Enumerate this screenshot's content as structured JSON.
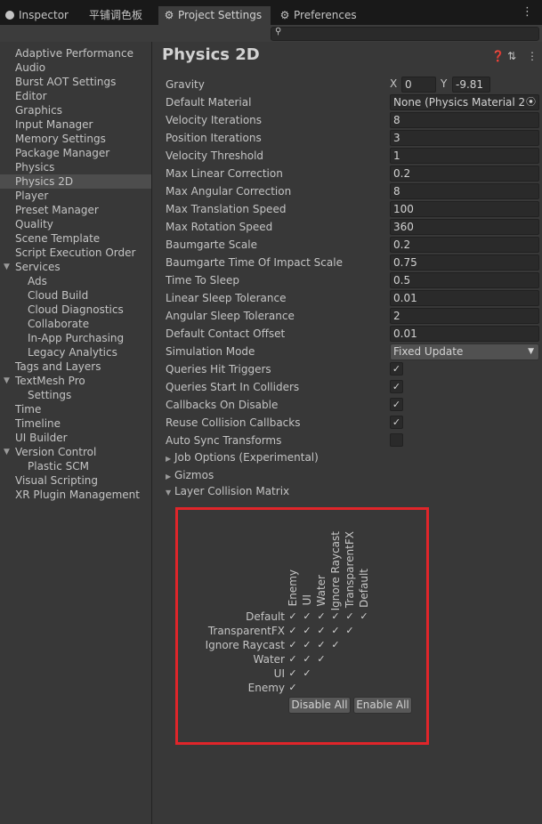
{
  "tabs": [
    {
      "label": "Inspector",
      "icon": "info-icon"
    },
    {
      "label": "平铺调色板",
      "icon": ""
    },
    {
      "label": "Project Settings",
      "icon": "gear-icon"
    },
    {
      "label": "Preferences",
      "icon": "gear-icon"
    }
  ],
  "sidebar": {
    "items": [
      {
        "label": "Adaptive Performance"
      },
      {
        "label": "Audio"
      },
      {
        "label": "Burst AOT Settings"
      },
      {
        "label": "Editor"
      },
      {
        "label": "Graphics"
      },
      {
        "label": "Input Manager"
      },
      {
        "label": "Memory Settings"
      },
      {
        "label": "Package Manager"
      },
      {
        "label": "Physics"
      },
      {
        "label": "Physics 2D",
        "selected": true
      },
      {
        "label": "Player"
      },
      {
        "label": "Preset Manager"
      },
      {
        "label": "Quality"
      },
      {
        "label": "Scene Template"
      },
      {
        "label": "Script Execution Order"
      },
      {
        "label": "Services",
        "expanded": true
      },
      {
        "label": "Ads"
      },
      {
        "label": "Cloud Build"
      },
      {
        "label": "Cloud Diagnostics"
      },
      {
        "label": "Collaborate"
      },
      {
        "label": "In-App Purchasing"
      },
      {
        "label": "Legacy Analytics"
      },
      {
        "label": "Tags and Layers"
      },
      {
        "label": "TextMesh Pro",
        "expanded": true
      },
      {
        "label": "Settings"
      },
      {
        "label": "Time"
      },
      {
        "label": "Timeline"
      },
      {
        "label": "UI Builder"
      },
      {
        "label": "Version Control",
        "expanded": true
      },
      {
        "label": "Plastic SCM"
      },
      {
        "label": "Visual Scripting"
      },
      {
        "label": "XR Plugin Management"
      }
    ]
  },
  "main": {
    "title": "Physics 2D",
    "header_icons": [
      "help-icon",
      "presets-icon",
      "more-icon"
    ],
    "gravity": {
      "label": "Gravity",
      "x_label": "X",
      "x": "0",
      "y_label": "Y",
      "y": "-9.81"
    },
    "default_material": {
      "label": "Default Material",
      "value": "None (Physics Material 2D"
    },
    "fields": [
      {
        "label": "Velocity Iterations",
        "value": "8"
      },
      {
        "label": "Position Iterations",
        "value": "3"
      },
      {
        "label": "Velocity Threshold",
        "value": "1"
      },
      {
        "label": "Max Linear Correction",
        "value": "0.2"
      },
      {
        "label": "Max Angular Correction",
        "value": "8"
      },
      {
        "label": "Max Translation Speed",
        "value": "100"
      },
      {
        "label": "Max Rotation Speed",
        "value": "360"
      },
      {
        "label": "Baumgarte Scale",
        "value": "0.2"
      },
      {
        "label": "Baumgarte Time Of Impact Scale",
        "value": "0.75"
      },
      {
        "label": "Time To Sleep",
        "value": "0.5"
      },
      {
        "label": "Linear Sleep Tolerance",
        "value": "0.01"
      },
      {
        "label": "Angular Sleep Tolerance",
        "value": "2"
      },
      {
        "label": "Default Contact Offset",
        "value": "0.01"
      }
    ],
    "simulation_mode": {
      "label": "Simulation Mode",
      "value": "Fixed Update"
    },
    "toggles": [
      {
        "label": "Queries Hit Triggers",
        "checked": true
      },
      {
        "label": "Queries Start In Colliders",
        "checked": true
      },
      {
        "label": "Callbacks On Disable",
        "checked": true
      },
      {
        "label": "Reuse Collision Callbacks",
        "checked": true
      },
      {
        "label": "Auto Sync Transforms",
        "checked": false
      }
    ],
    "foldouts": [
      {
        "label": "Job Options (Experimental)",
        "expanded": false
      },
      {
        "label": "Gizmos",
        "expanded": false
      },
      {
        "label": "Layer Collision Matrix",
        "expanded": true
      }
    ],
    "matrix": {
      "columns": [
        "Enemy",
        "UI",
        "Water",
        "Ignore Raycast",
        "TransparentFX",
        "Default"
      ],
      "rows": [
        "Default",
        "TransparentFX",
        "Ignore Raycast",
        "Water",
        "UI",
        "Enemy"
      ],
      "disable_all": "Disable All",
      "enable_all": "Enable All"
    }
  },
  "colors": {
    "highlight": "#e0252a",
    "background": "#383838",
    "tabbar": "#191919"
  }
}
